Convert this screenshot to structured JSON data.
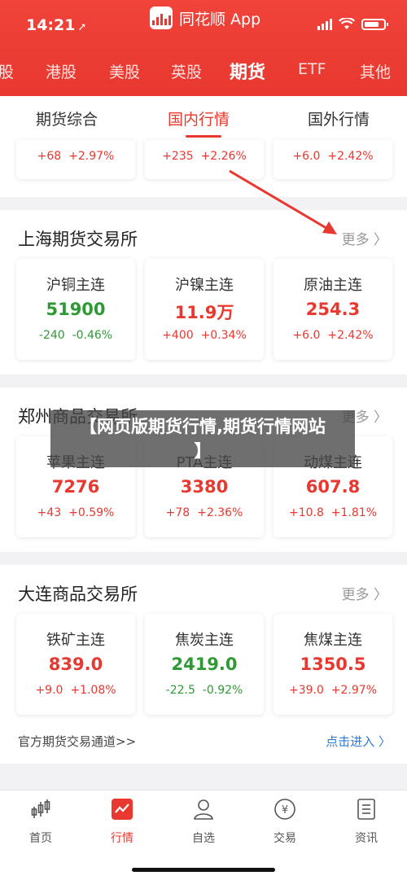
{
  "status_bar": {
    "time": "14:21",
    "app_name": "同花顺 App"
  },
  "market_tabs": [
    "股",
    "港股",
    "美股",
    "英股",
    "期货",
    "ETF",
    "其他"
  ],
  "market_tab_active": "期货",
  "sub_tabs": [
    "期货综合",
    "国内行情",
    "国外行情"
  ],
  "sub_tab_active": "国内行情",
  "top_row": [
    {
      "change": "+68",
      "pct": "+2.97%"
    },
    {
      "change": "+235",
      "pct": "+2.26%"
    },
    {
      "change": "+6.0",
      "pct": "+2.42%"
    }
  ],
  "sections": [
    {
      "title": "上海期货交易所",
      "more": "更多",
      "items": [
        {
          "name": "沪铜主连",
          "price": "51900",
          "change": "-240",
          "pct": "-0.46%",
          "trend": "down"
        },
        {
          "name": "沪镍主连",
          "price": "11.9万",
          "change": "+400",
          "pct": "+0.34%",
          "trend": "up"
        },
        {
          "name": "原油主连",
          "price": "254.3",
          "change": "+6.0",
          "pct": "+2.42%",
          "trend": "up"
        }
      ]
    },
    {
      "title": "郑州商品交易所",
      "more": "更多",
      "items": [
        {
          "name": "苹果主连",
          "price": "7276",
          "change": "+43",
          "pct": "+0.59%",
          "trend": "up"
        },
        {
          "name": "PTA主连",
          "price": "3380",
          "change": "+78",
          "pct": "+2.36%",
          "trend": "up"
        },
        {
          "name": "动煤主连",
          "price": "607.8",
          "change": "+10.8",
          "pct": "+1.81%",
          "trend": "up"
        }
      ]
    },
    {
      "title": "大连商品交易所",
      "more": "更多",
      "items": [
        {
          "name": "铁矿主连",
          "price": "839.0",
          "change": "+9.0",
          "pct": "+1.08%",
          "trend": "up"
        },
        {
          "name": "焦炭主连",
          "price": "2419.0",
          "change": "-22.5",
          "pct": "-0.92%",
          "trend": "down"
        },
        {
          "name": "焦煤主连",
          "price": "1350.5",
          "change": "+39.0",
          "pct": "+2.97%",
          "trend": "up"
        }
      ]
    }
  ],
  "channel_link": {
    "label": "官方期货交易通道>>",
    "action": "点击进入"
  },
  "overlay_banner": {
    "line1": "【网页版期货行情,期货行情网站",
    "line2": "】"
  },
  "bottom_tabs": [
    {
      "label": "首页",
      "icon": "candlestick-icon"
    },
    {
      "label": "行情",
      "icon": "chart-icon"
    },
    {
      "label": "自选",
      "icon": "person-icon"
    },
    {
      "label": "交易",
      "icon": "yen-icon"
    },
    {
      "label": "资讯",
      "icon": "news-icon"
    }
  ],
  "bottom_tab_active": "行情",
  "colors": {
    "brand": "#e8382f",
    "up": "#e8382f",
    "down": "#2f9a35",
    "link": "#2f7bd8"
  }
}
